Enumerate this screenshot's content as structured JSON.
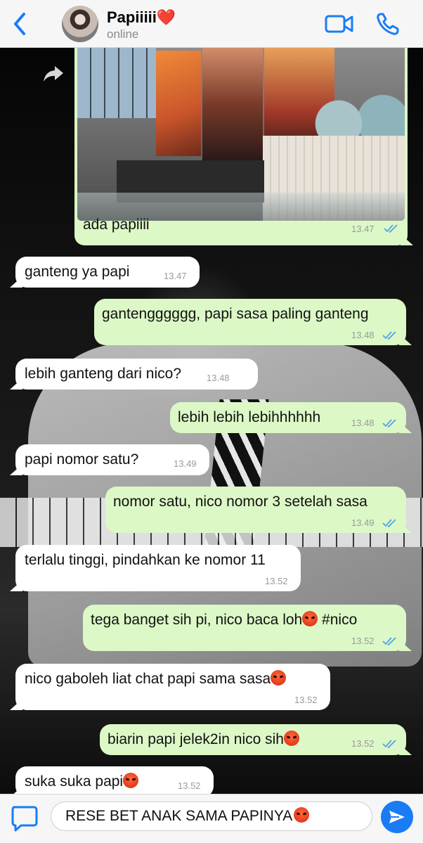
{
  "header": {
    "contact_name": "Papiiiii",
    "heart": "❤️",
    "status": "online",
    "icons": [
      "chevron-left-icon",
      "video-camera-icon",
      "phone-icon"
    ]
  },
  "colors": {
    "accent": "#1a7cf5",
    "outgoing_bubble": "#dcf8c6",
    "incoming_bubble": "#ffffff",
    "read_ticks": "#4fa3e8"
  },
  "messages": [
    {
      "dir": "out",
      "type": "photo",
      "text": "ada papiiii",
      "time": "13.47",
      "read": true
    },
    {
      "dir": "in",
      "text": "ganteng ya papi",
      "time": "13.47"
    },
    {
      "dir": "out",
      "text": "gantengggggg, papi sasa paling ganteng",
      "time": "13.48",
      "read": true
    },
    {
      "dir": "in",
      "text": "lebih ganteng dari nico?",
      "time": "13.48"
    },
    {
      "dir": "out",
      "text": "lebih lebih lebihhhhhh",
      "time": "13.48",
      "read": true
    },
    {
      "dir": "in",
      "text": "papi nomor satu?",
      "time": "13.49"
    },
    {
      "dir": "out",
      "text": "nomor satu, nico nomor 3 setelah sasa",
      "time": "13.49",
      "read": true
    },
    {
      "dir": "in",
      "text": "terlalu tinggi, pindahkan ke nomor 11",
      "time": "13.52"
    },
    {
      "dir": "out",
      "text_before": "tega banget sih pi, nico baca loh",
      "emoji": "angry-face",
      "text_after": " #nico",
      "time": "13.52",
      "read": true
    },
    {
      "dir": "in",
      "text_before": "nico gaboleh liat chat papi sama sasa",
      "emoji": "angry-face",
      "time": "13.52"
    },
    {
      "dir": "out",
      "text_before": "biarin papi jelek2in nico sih",
      "emoji": "angry-face",
      "time": "13.52",
      "read": true
    },
    {
      "dir": "in",
      "text_before": "suka suka papi",
      "emoji": "angry-face",
      "time": "13.52"
    }
  ],
  "composer": {
    "value": "RESE BET ANAK SAMA PAPINYA",
    "emoji": "angry-face",
    "icons": [
      "attach-icon",
      "send-icon"
    ]
  }
}
